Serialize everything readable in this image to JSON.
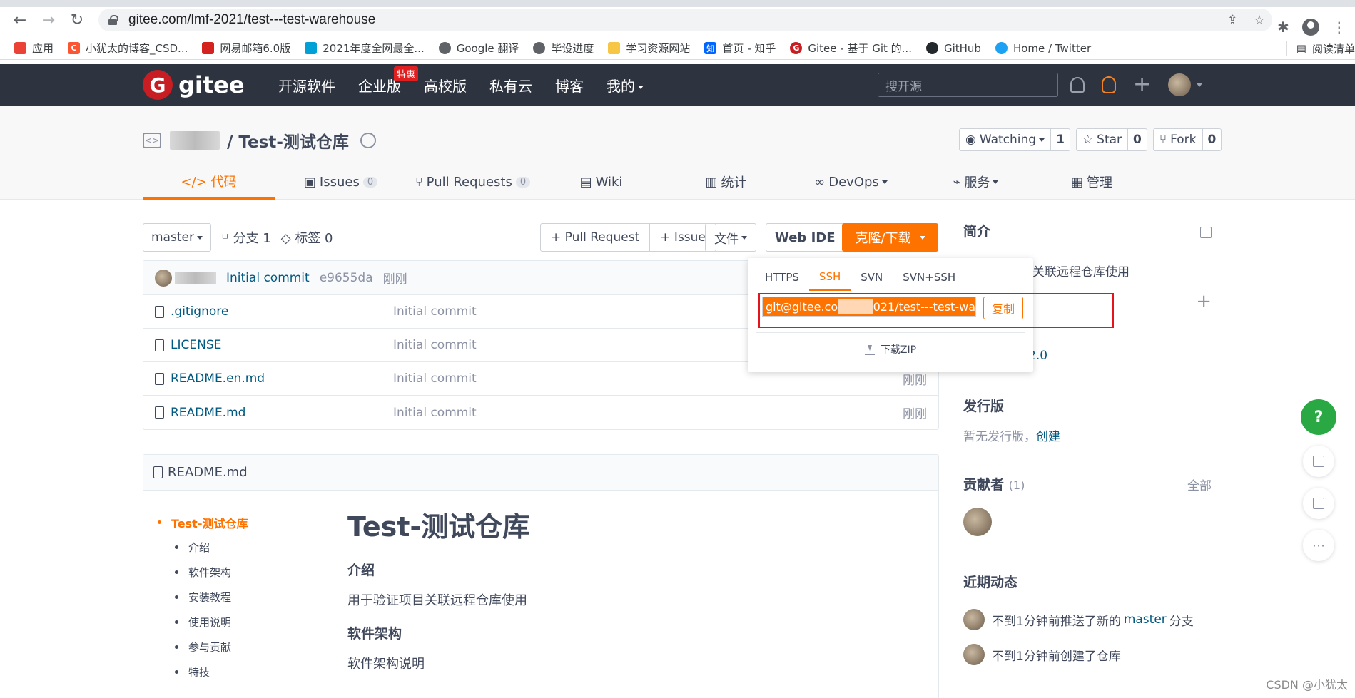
{
  "browser": {
    "url": "gitee.com/lmf-2021/test---test-warehouse",
    "bookmarks": [
      {
        "label": "应用",
        "color": "#ea4335"
      },
      {
        "label": "小犹太的博客_CSD...",
        "color": "#fc5531"
      },
      {
        "label": "网易邮箱6.0版",
        "color": "#d4231e"
      },
      {
        "label": "2021年度全网最全...",
        "color": "#00a1d6"
      },
      {
        "label": "Google 翻译",
        "color": "#5f6368"
      },
      {
        "label": "毕设进度",
        "color": "#5f6368"
      },
      {
        "label": "学习资源网站",
        "color": "#f6c644"
      },
      {
        "label": "首页 - 知乎",
        "color": "#0066ff"
      },
      {
        "label": "Gitee - 基于 Git 的...",
        "color": "#c71d23"
      },
      {
        "label": "GitHub",
        "color": "#24292e"
      },
      {
        "label": "Home / Twitter",
        "color": "#1da1f2"
      }
    ],
    "reading_list": "阅读清单"
  },
  "header": {
    "logo_letter": "G",
    "logo_text": "gitee",
    "nav": [
      "开源软件",
      "企业版",
      "高校版",
      "私有云",
      "博客",
      "我的"
    ],
    "enterprise_badge": "特惠",
    "search_placeholder": "搜开源"
  },
  "repo": {
    "code_icon": "<>",
    "title": "/ Test-测试仓库",
    "watch_label": "Watching",
    "watch_count": "1",
    "star_label": "Star",
    "star_count": "0",
    "fork_label": "Fork",
    "fork_count": "0",
    "tabs": [
      {
        "label": "</> 代码",
        "count": ""
      },
      {
        "label": "Issues",
        "count": "0"
      },
      {
        "label": "Pull Requests",
        "count": "0"
      },
      {
        "label": "Wiki",
        "count": ""
      },
      {
        "label": "统计",
        "count": ""
      },
      {
        "label": "DevOps",
        "count": ""
      },
      {
        "label": "服务",
        "count": ""
      },
      {
        "label": "管理",
        "count": ""
      }
    ]
  },
  "toolbar": {
    "branch": "master",
    "branches": "分支 1",
    "tags": "标签 0",
    "pull_request": "+ Pull Request",
    "issue": "+ Issue",
    "file": "文件",
    "web_ide": "Web IDE",
    "clone": "克隆/下载"
  },
  "commit": {
    "message": "Initial commit",
    "sha": "e9655da",
    "time": "刚刚"
  },
  "files": [
    {
      "name": ".gitignore",
      "message": "Initial commit",
      "time": ""
    },
    {
      "name": "LICENSE",
      "message": "Initial commit",
      "time": ""
    },
    {
      "name": "README.en.md",
      "message": "Initial commit",
      "time": "刚刚"
    },
    {
      "name": "README.md",
      "message": "Initial commit",
      "time": "刚刚"
    }
  ],
  "clone_popup": {
    "tabs": [
      "HTTPS",
      "SSH",
      "SVN",
      "SVN+SSH"
    ],
    "active_tab": "SSH",
    "url_start": "git@gitee.co",
    "url_end": "021/test---test-wa",
    "copy": "复制",
    "download_zip": "下载ZIP"
  },
  "readme": {
    "file": "README.md",
    "toc": [
      "Test-测试仓库",
      "介绍",
      "软件架构",
      "安装教程",
      "使用说明",
      "参与贡献",
      "特技"
    ],
    "h1": "Test-测试仓库",
    "intro_title": "介绍",
    "intro_text": "用于验证项目关联远程仓库使用",
    "arch_title": "软件架构",
    "arch_text": "软件架构说明"
  },
  "sidebar": {
    "intro_title": "简介",
    "intro_desc": "目关联远程仓库使用",
    "license_partial": "2.0",
    "release_title": "发行版",
    "release_desc": "暂无发行版，",
    "release_create": "创建",
    "contrib_title": "贡献者",
    "contrib_count": "(1)",
    "contrib_all": "全部",
    "activity_title": "近期动态",
    "activity_1_pre": "不到1分钟前推送了新的",
    "activity_1_link": "master",
    "activity_1_post": "分支",
    "activity_2": "不到1分钟前创建了仓库"
  },
  "help_label": "?",
  "watermark": "CSDN @小犹太"
}
